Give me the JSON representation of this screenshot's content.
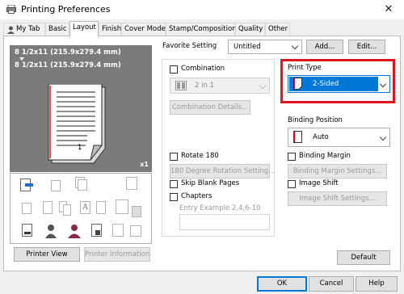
{
  "window": {
    "title": "Printing Preferences",
    "close_glyph": "✕"
  },
  "tabs": [
    {
      "label": "My Tab"
    },
    {
      "label": "Basic"
    },
    {
      "label": "Layout"
    },
    {
      "label": "Finish"
    },
    {
      "label": "Cover Mode"
    },
    {
      "label": "Stamp/Composition"
    },
    {
      "label": "Quality"
    },
    {
      "label": "Other"
    }
  ],
  "favorite": {
    "label": "Favorite Setting",
    "value": "Untitled",
    "add_label": "Add...",
    "edit_label": "Edit..."
  },
  "preview": {
    "line1": "8 1/2x11 (215.9x279.4 mm)",
    "line2": "8 1/2x11 (215.9x279.4 mm)",
    "scale": "x1",
    "page_number": "1"
  },
  "combination": {
    "label": "Combination",
    "value": "2 in 1",
    "details_label": "Combination Details..."
  },
  "print_type": {
    "label": "Print Type",
    "value": "2-Sided",
    "selected_color": "#0078d7"
  },
  "binding_position": {
    "label": "Binding Position",
    "value": "Auto"
  },
  "rotate": {
    "label": "Rotate 180",
    "settings_label": "180 Degree Rotation Setting..."
  },
  "skip_blank": {
    "label": "Skip Blank Pages"
  },
  "chapters": {
    "label": "Chapters",
    "example": "Entry Example 2,4,6-10"
  },
  "binding_margin": {
    "label": "Binding Margin",
    "settings_label": "Binding Margin Settings..."
  },
  "image_shift": {
    "label": "Image Shift",
    "settings_label": "Image Shift Settings..."
  },
  "buttons": {
    "printer_view": "Printer View",
    "printer_information": "Printer Information",
    "default": "Default",
    "ok": "OK",
    "cancel": "Cancel",
    "help": "Help"
  },
  "colors": {
    "highlight_border": "#e0141e",
    "panel_bg": "#ffffff",
    "preview_bg": "#7b7b7b"
  }
}
